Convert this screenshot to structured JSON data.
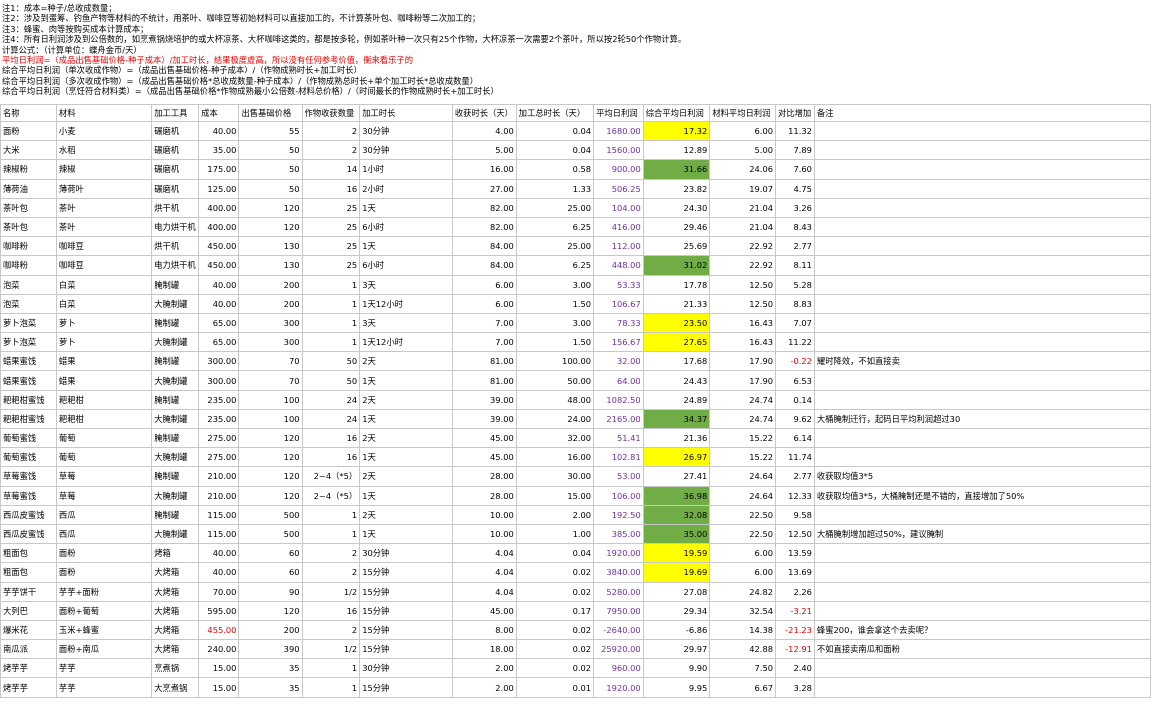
{
  "notes": [
    {
      "text": "注1：成本=种子/总收成数量；",
      "red": false
    },
    {
      "text": "注2：涉及到蛋筹、钓鱼产物等材料的不统计，用茶叶、咖啡豆等初始材料可以直接加工的，不计算茶叶包、咖啡粉等二次加工的；",
      "red": false
    },
    {
      "text": "注3：蜂蜜、肉等按购买成本计算成本；",
      "red": false
    },
    {
      "text": "注4：所有日利润涉及到公倍数的，如烹煮锅烧培护的或大杯凉茶、大杯咖啡这类的，都是按多轮，例如茶叶种一次只有25个作物，大杯凉茶一次需要2个茶叶，所以按2轮50个作物计算。",
      "red": false
    },
    {
      "text": "计算公式：（计算单位：蝶舟金币/天）",
      "red": false
    },
    {
      "text": "平均日利润=（成品出售基础价格-种子成本）/加工时长，结果极度虚高，所以没有任何参考价值，衡来看乐子的",
      "red": true
    },
    {
      "text": "综合平均日利润（单次收成作物）=（成品出售基础价格-种子成本）/（作物成熟时长+加工时长）",
      "red": false
    },
    {
      "text": "综合平均日利润（多次收成作物）=（成品出售基础价格*总收成数量-种子成本）/（作物成熟总时长+单个加工时长*总收成数量）",
      "red": false
    },
    {
      "text": "综合平均日利润（烹饪符合材料类）=（成品出售基础价格*作物成熟最小公倍数-材料总价格）/（时间最长的作物成熟时长+加工时长）",
      "red": false
    }
  ],
  "headers": [
    "名称",
    "材料",
    "加工工具",
    "成本",
    "出售基础价格",
    "作物收获数量",
    "加工时长",
    "收获时长（天）",
    "加工总时长（天）",
    "平均日利润",
    "综合平均日利润",
    "材料平均日利润",
    "对比增加",
    "备注"
  ],
  "rows": [
    {
      "name": "面粉",
      "material": "小麦",
      "tool": "碾磨机",
      "cost": "40.00",
      "price": "55",
      "qty": "2",
      "ptime": "30分钟",
      "harvest": "4.00",
      "total": "0.04",
      "avg": "1680.00",
      "combo": "17.32",
      "mat": "6.00",
      "diff": "11.32",
      "note": "",
      "hl": "yellow"
    },
    {
      "name": "大米",
      "material": "水稻",
      "tool": "碾磨机",
      "cost": "35.00",
      "price": "50",
      "qty": "2",
      "ptime": "30分钟",
      "harvest": "5.00",
      "total": "0.04",
      "avg": "1560.00",
      "combo": "12.89",
      "mat": "5.00",
      "diff": "7.89",
      "note": "",
      "hl": ""
    },
    {
      "name": "辣椒粉",
      "material": "辣椒",
      "tool": "碾磨机",
      "cost": "175.00",
      "price": "50",
      "qty": "14",
      "ptime": "1小时",
      "harvest": "16.00",
      "total": "0.58",
      "avg": "900.00",
      "combo": "31.66",
      "mat": "24.06",
      "diff": "7.60",
      "note": "",
      "hl": "green"
    },
    {
      "name": "薄荷油",
      "material": "薄荷叶",
      "tool": "碾磨机",
      "cost": "125.00",
      "price": "50",
      "qty": "16",
      "ptime": "2小时",
      "harvest": "27.00",
      "total": "1.33",
      "avg": "506.25",
      "combo": "23.82",
      "mat": "19.07",
      "diff": "4.75",
      "note": "",
      "hl": ""
    },
    {
      "name": "茶叶包",
      "material": "茶叶",
      "tool": "烘干机",
      "cost": "400.00",
      "price": "120",
      "qty": "25",
      "ptime": "1天",
      "harvest": "82.00",
      "total": "25.00",
      "avg": "104.00",
      "combo": "24.30",
      "mat": "21.04",
      "diff": "3.26",
      "note": "",
      "hl": ""
    },
    {
      "name": "茶叶包",
      "material": "茶叶",
      "tool": "电力烘干机",
      "cost": "400.00",
      "price": "120",
      "qty": "25",
      "ptime": "6小时",
      "harvest": "82.00",
      "total": "6.25",
      "avg": "416.00",
      "combo": "29.46",
      "mat": "21.04",
      "diff": "8.43",
      "note": "",
      "hl": ""
    },
    {
      "name": "咖啡粉",
      "material": "咖啡豆",
      "tool": "烘干机",
      "cost": "450.00",
      "price": "130",
      "qty": "25",
      "ptime": "1天",
      "harvest": "84.00",
      "total": "25.00",
      "avg": "112.00",
      "combo": "25.69",
      "mat": "22.92",
      "diff": "2.77",
      "note": "",
      "hl": ""
    },
    {
      "name": "咖啡粉",
      "material": "咖啡豆",
      "tool": "电力烘干机",
      "cost": "450.00",
      "price": "130",
      "qty": "25",
      "ptime": "6小时",
      "harvest": "84.00",
      "total": "6.25",
      "avg": "448.00",
      "combo": "31.02",
      "mat": "22.92",
      "diff": "8.11",
      "note": "",
      "hl": "green"
    },
    {
      "name": "泡菜",
      "material": "白菜",
      "tool": "腌制罐",
      "cost": "40.00",
      "price": "200",
      "qty": "1",
      "ptime": "3天",
      "harvest": "6.00",
      "total": "3.00",
      "avg": "53.33",
      "combo": "17.78",
      "mat": "12.50",
      "diff": "5.28",
      "note": "",
      "hl": ""
    },
    {
      "name": "泡菜",
      "material": "白菜",
      "tool": "大腌制罐",
      "cost": "40.00",
      "price": "200",
      "qty": "1",
      "ptime": "1天12小时",
      "harvest": "6.00",
      "total": "1.50",
      "avg": "106.67",
      "combo": "21.33",
      "mat": "12.50",
      "diff": "8.83",
      "note": "",
      "hl": ""
    },
    {
      "name": "萝卜泡菜",
      "material": "萝卜",
      "tool": "腌制罐",
      "cost": "65.00",
      "price": "300",
      "qty": "1",
      "ptime": "3天",
      "harvest": "7.00",
      "total": "3.00",
      "avg": "78.33",
      "combo": "23.50",
      "mat": "16.43",
      "diff": "7.07",
      "note": "",
      "hl": "yellow"
    },
    {
      "name": "萝卜泡菜",
      "material": "萝卜",
      "tool": "大腌制罐",
      "cost": "65.00",
      "price": "300",
      "qty": "1",
      "ptime": "1天12小时",
      "harvest": "7.00",
      "total": "1.50",
      "avg": "156.67",
      "combo": "27.65",
      "mat": "16.43",
      "diff": "11.22",
      "note": "",
      "hl": "yellow"
    },
    {
      "name": "蜡果蜜饯",
      "material": "蜡果",
      "tool": "腌制罐",
      "cost": "300.00",
      "price": "70",
      "qty": "50",
      "ptime": "2天",
      "harvest": "81.00",
      "total": "100.00",
      "avg": "32.00",
      "combo": "17.68",
      "mat": "17.90",
      "diff": "-0.22",
      "note": "耀时降效，不如直接卖",
      "hl": ""
    },
    {
      "name": "蜡果蜜饯",
      "material": "蜡果",
      "tool": "大腌制罐",
      "cost": "300.00",
      "price": "70",
      "qty": "50",
      "ptime": "1天",
      "harvest": "81.00",
      "total": "50.00",
      "avg": "64.00",
      "combo": "24.43",
      "mat": "17.90",
      "diff": "6.53",
      "note": "",
      "hl": ""
    },
    {
      "name": "耙耙柑蜜饯",
      "material": "耙耙柑",
      "tool": "腌制罐",
      "cost": "235.00",
      "price": "100",
      "qty": "24",
      "ptime": "2天",
      "harvest": "39.00",
      "total": "48.00",
      "avg": "1082.50",
      "combo": "24.89",
      "mat": "24.74",
      "diff": "0.14",
      "note": "",
      "hl": ""
    },
    {
      "name": "耙耙柑蜜饯",
      "material": "耙耙柑",
      "tool": "大腌制罐",
      "cost": "235.00",
      "price": "100",
      "qty": "24",
      "ptime": "1天",
      "harvest": "39.00",
      "total": "24.00",
      "avg": "2165.00",
      "combo": "34.37",
      "mat": "24.74",
      "diff": "9.62",
      "note": "大桶腌制迁行，起码日平均利润超过30",
      "hl": "green"
    },
    {
      "name": "葡萄蜜饯",
      "material": "葡萄",
      "tool": "腌制罐",
      "cost": "275.00",
      "price": "120",
      "qty": "16",
      "ptime": "2天",
      "harvest": "45.00",
      "total": "32.00",
      "avg": "51.41",
      "combo": "21.36",
      "mat": "15.22",
      "diff": "6.14",
      "note": "",
      "hl": ""
    },
    {
      "name": "葡萄蜜饯",
      "material": "葡萄",
      "tool": "大腌制罐",
      "cost": "275.00",
      "price": "120",
      "qty": "16",
      "ptime": "1天",
      "harvest": "45.00",
      "total": "16.00",
      "avg": "102.81",
      "combo": "26.97",
      "mat": "15.22",
      "diff": "11.74",
      "note": "",
      "hl": "yellow"
    },
    {
      "name": "草莓蜜饯",
      "material": "草莓",
      "tool": "腌制罐",
      "cost": "210.00",
      "price": "120",
      "qty": "2~4（*5）",
      "ptime": "2天",
      "harvest": "28.00",
      "total": "30.00",
      "avg": "53.00",
      "combo": "27.41",
      "mat": "24.64",
      "diff": "2.77",
      "note": "收获取均值3*5",
      "hl": ""
    },
    {
      "name": "草莓蜜饯",
      "material": "草莓",
      "tool": "大腌制罐",
      "cost": "210.00",
      "price": "120",
      "qty": "2~4（*5）",
      "ptime": "1天",
      "harvest": "28.00",
      "total": "15.00",
      "avg": "106.00",
      "combo": "36.98",
      "mat": "24.64",
      "diff": "12.33",
      "note": "收获取均值3*5，大桶腌制还是不错的，直接增加了50%",
      "hl": "green"
    },
    {
      "name": "西瓜皮蜜饯",
      "material": "西瓜",
      "tool": "腌制罐",
      "cost": "115.00",
      "price": "500",
      "qty": "1",
      "ptime": "2天",
      "harvest": "10.00",
      "total": "2.00",
      "avg": "192.50",
      "combo": "32.08",
      "mat": "22.50",
      "diff": "9.58",
      "note": "",
      "hl": "green"
    },
    {
      "name": "西瓜皮蜜饯",
      "material": "西瓜",
      "tool": "大腌制罐",
      "cost": "115.00",
      "price": "500",
      "qty": "1",
      "ptime": "1天",
      "harvest": "10.00",
      "total": "1.00",
      "avg": "385.00",
      "combo": "35.00",
      "mat": "22.50",
      "diff": "12.50",
      "note": "大桶腌制增加超过50%，建议腌制",
      "hl": "green"
    },
    {
      "name": "粗面包",
      "material": "面粉",
      "tool": "烤箱",
      "cost": "40.00",
      "price": "60",
      "qty": "2",
      "ptime": "30分钟",
      "harvest": "4.04",
      "total": "0.04",
      "avg": "1920.00",
      "combo": "19.59",
      "mat": "6.00",
      "diff": "13.59",
      "note": "",
      "hl": "yellow"
    },
    {
      "name": "粗面包",
      "material": "面粉",
      "tool": "大烤箱",
      "cost": "40.00",
      "price": "60",
      "qty": "2",
      "ptime": "15分钟",
      "harvest": "4.04",
      "total": "0.02",
      "avg": "3840.00",
      "combo": "19.69",
      "mat": "6.00",
      "diff": "13.69",
      "note": "",
      "hl": "yellow"
    },
    {
      "name": "芋芋饼干",
      "material": "芋芋+面粉",
      "tool": "大烤箱",
      "cost": "70.00",
      "price": "90",
      "qty": "1/2",
      "ptime": "15分钟",
      "harvest": "4.04",
      "total": "0.02",
      "avg": "5280.00",
      "combo": "27.08",
      "mat": "24.82",
      "diff": "2.26",
      "note": "",
      "hl": ""
    },
    {
      "name": "大列巴",
      "material": "面粉+葡萄",
      "tool": "大烤箱",
      "cost": "595.00",
      "price": "120",
      "qty": "16",
      "ptime": "15分钟",
      "harvest": "45.00",
      "total": "0.17",
      "avg": "7950.00",
      "combo": "29.34",
      "mat": "32.54",
      "diff": "-3.21",
      "note": "",
      "hl": ""
    },
    {
      "name": "爆米花",
      "material": "玉米+蜂蜜",
      "tool": "大烤箱",
      "cost": "455.00",
      "price": "200",
      "qty": "2",
      "ptime": "15分钟",
      "harvest": "8.00",
      "total": "0.02",
      "avg": "-2640.00",
      "combo": "-6.86",
      "mat": "14.38",
      "diff": "-21.23",
      "note": "蜂蜜200，谁会拿这个去卖呢？",
      "hl": ""
    },
    {
      "name": "南瓜派",
      "material": "面粉+南瓜",
      "tool": "大烤箱",
      "cost": "240.00",
      "price": "390",
      "qty": "1/2",
      "ptime": "15分钟",
      "harvest": "18.00",
      "total": "0.02",
      "avg": "25920.00",
      "combo": "29.97",
      "mat": "42.88",
      "diff": "-12.91",
      "note": "不如直接卖南瓜和面粉",
      "hl": ""
    },
    {
      "name": "烤芋芋",
      "material": "芋芋",
      "tool": "烹煮锅",
      "cost": "15.00",
      "price": "35",
      "qty": "1",
      "ptime": "30分钟",
      "harvest": "2.00",
      "total": "0.02",
      "avg": "960.00",
      "combo": "9.90",
      "mat": "7.50",
      "diff": "2.40",
      "note": "",
      "hl": ""
    },
    {
      "name": "烤芋芋",
      "material": "芋芋",
      "tool": "大烹煮锅",
      "cost": "15.00",
      "price": "35",
      "qty": "1",
      "ptime": "15分钟",
      "harvest": "2.00",
      "total": "0.01",
      "avg": "1920.00",
      "combo": "9.95",
      "mat": "6.67",
      "diff": "3.28",
      "note": "",
      "hl": ""
    }
  ],
  "colors": {
    "yellow": "#ffff00",
    "green": "#70ad47",
    "purple": "#7030a0",
    "red": "#e60000"
  }
}
